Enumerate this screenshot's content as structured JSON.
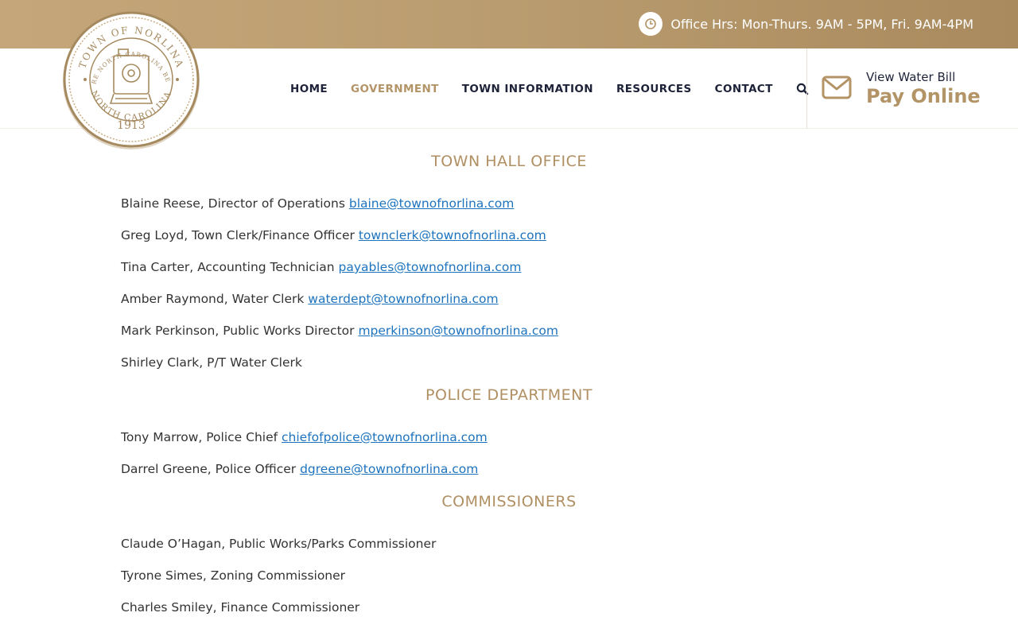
{
  "topbar": {
    "hours": "Office Hrs: Mon-Thurs. 9AM - 5PM, Fri. 9AM-4PM"
  },
  "logo": {
    "top_arc": "TOWN OF NORLINA",
    "inner_arc": "WHERE NORTH CAROLINA BEGINS",
    "year": "1913",
    "bottom_arc": "NORTH CAROLINA"
  },
  "nav": {
    "items": [
      "HOME",
      "GOVERNMENT",
      "TOWN INFORMATION",
      "RESOURCES",
      "CONTACT"
    ],
    "active": "GOVERNMENT"
  },
  "water": {
    "small": "View Water Bill",
    "big": "Pay Online"
  },
  "sections": [
    {
      "heading": "TOWN HALL OFFICE",
      "entries": [
        {
          "text": "Blaine Reese, Director of Operations",
          "email": "blaine@townofnorlina.com"
        },
        {
          "text": "Greg Loyd, Town Clerk/Finance Officer",
          "email": "townclerk@townofnorlina.com"
        },
        {
          "text": "Tina Carter, Accounting Technician",
          "email": "payables@townofnorlina.com"
        },
        {
          "text": "Amber Raymond, Water Clerk",
          "email": "waterdept@townofnorlina.com"
        },
        {
          "text": "Mark Perkinson, Public Works Director",
          "email": "mperkinson@townofnorlina.com"
        },
        {
          "text": "Shirley Clark, P/T Water Clerk",
          "email": ""
        }
      ]
    },
    {
      "heading": "POLICE DEPARTMENT",
      "entries": [
        {
          "text": "Tony Marrow, Police Chief",
          "email": "chiefofpolice@townofnorlina.com"
        },
        {
          "text": "Darrel Greene, Police Officer",
          "email": "dgreene@townofnorlina.com"
        }
      ]
    },
    {
      "heading": "COMMISSIONERS",
      "entries": [
        {
          "text": "Claude O’Hagan, Public Works/Parks Commissioner",
          "email": ""
        },
        {
          "text": "Tyrone Simes, Zoning Commissioner",
          "email": ""
        },
        {
          "text": "Charles Smiley, Finance Commissioner",
          "email": ""
        }
      ]
    }
  ],
  "colors": {
    "gold": "#b39467",
    "navy": "#1d2238",
    "link": "#1e73be"
  },
  "icons": {
    "hours": "clock-icon",
    "search": "search-icon",
    "water": "envelope-icon"
  }
}
